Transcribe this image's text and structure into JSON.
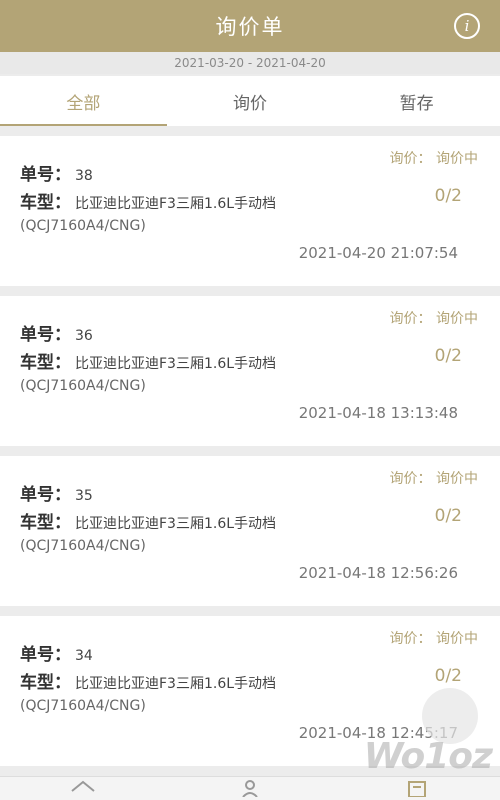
{
  "header": {
    "title": "询价单",
    "info_icon": "info-icon"
  },
  "date_range": "2021-03-20 - 2021-04-20",
  "tabs": [
    {
      "label": "全部",
      "active": true
    },
    {
      "label": "询价",
      "active": false
    },
    {
      "label": "暂存",
      "active": false
    }
  ],
  "labels": {
    "order": "单号：",
    "car": "车型："
  },
  "orders": [
    {
      "status": "询价：  询价中",
      "order_no": "38",
      "car": "比亚迪比亚迪F3三厢1.6L手动档",
      "model": "(QCJ7160A4/CNG)",
      "count": "0/2",
      "time": "2021-04-20 21:07:54"
    },
    {
      "status": "询价：  询价中",
      "order_no": "36",
      "car": "比亚迪比亚迪F3三厢1.6L手动档",
      "model": "(QCJ7160A4/CNG)",
      "count": "0/2",
      "time": "2021-04-18 13:13:48"
    },
    {
      "status": "询价：  询价中",
      "order_no": "35",
      "car": "比亚迪比亚迪F3三厢1.6L手动档",
      "model": "(QCJ7160A4/CNG)",
      "count": "0/2",
      "time": "2021-04-18 12:56:26"
    },
    {
      "status": "询价：  询价中",
      "order_no": "34",
      "car": "比亚迪比亚迪F3三厢1.6L手动档",
      "model": "(QCJ7160A4/CNG)",
      "count": "0/2",
      "time": "2021-04-18 12:45:17"
    }
  ],
  "bottom_nav": [
    {
      "icon": "home-icon"
    },
    {
      "icon": "user-icon"
    },
    {
      "icon": "document-icon"
    }
  ],
  "watermark": "Wo1oz",
  "colors": {
    "accent": "#b3a476",
    "background": "#ececec"
  }
}
